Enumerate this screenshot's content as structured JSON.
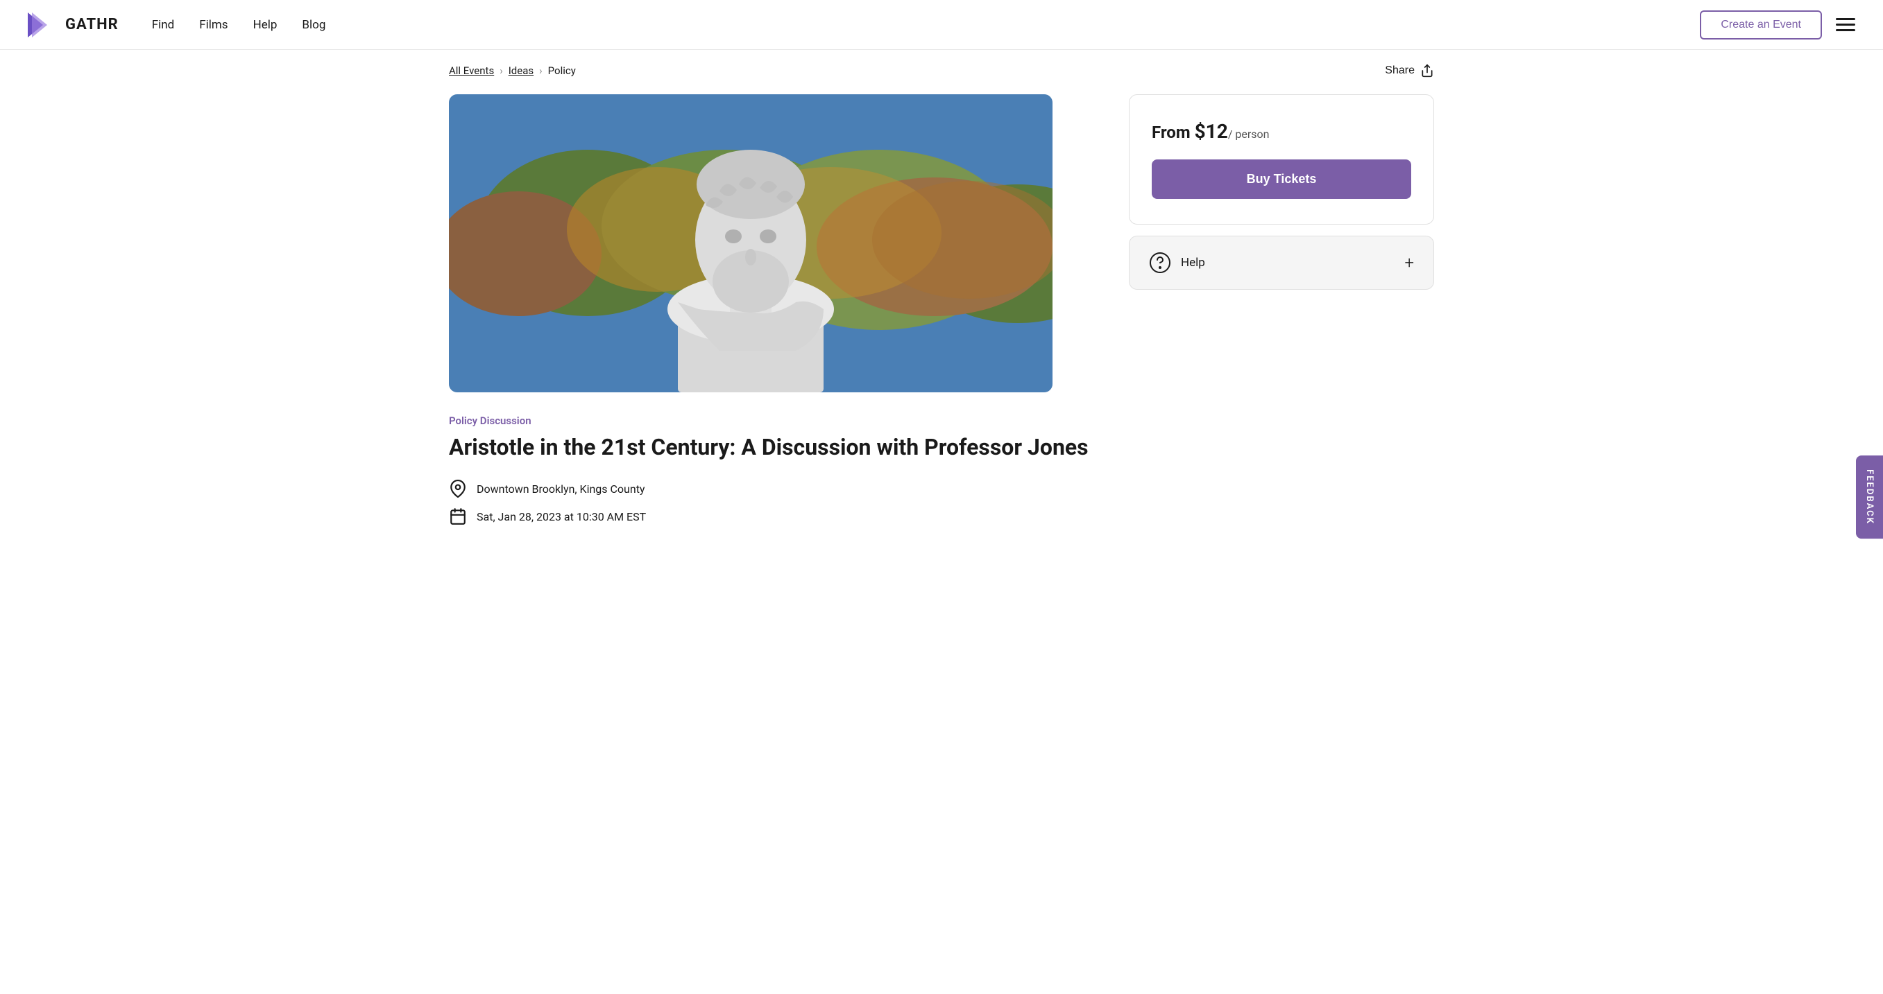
{
  "navbar": {
    "logo_text": "GATHR",
    "nav_links": [
      {
        "label": "Find",
        "href": "#"
      },
      {
        "label": "Films",
        "href": "#"
      },
      {
        "label": "Help",
        "href": "#"
      },
      {
        "label": "Blog",
        "href": "#"
      }
    ],
    "create_event_label": "Create an Event",
    "hamburger_aria": "Menu"
  },
  "breadcrumb": {
    "all_events": "All Events",
    "ideas": "Ideas",
    "policy": "Policy"
  },
  "share": {
    "label": "Share"
  },
  "event": {
    "category": "Policy Discussion",
    "title": "Aristotle in the 21st Century: A Discussion with Professor Jones",
    "location": "Downtown Brooklyn, Kings County",
    "date": "Sat, Jan 28, 2023 at 10:30 AM EST"
  },
  "ticket_card": {
    "from_label": "From ",
    "price": "$12",
    "per_person": "/ person",
    "buy_button": "Buy Tickets"
  },
  "help_card": {
    "label": "Help",
    "plus": "+"
  },
  "feedback": {
    "label": "FEEDBACK"
  }
}
